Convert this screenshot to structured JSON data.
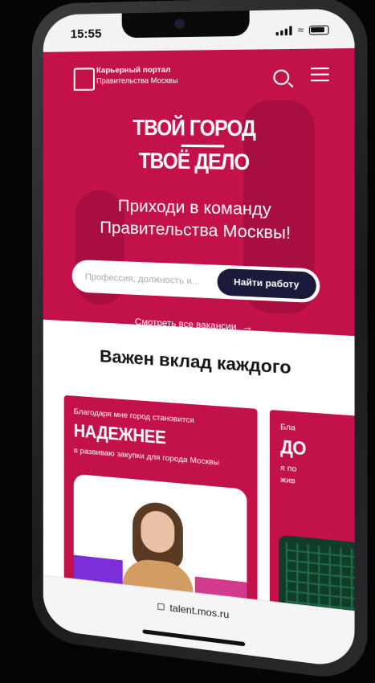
{
  "status": {
    "time": "15:55"
  },
  "header": {
    "portal_line1": "Карьерный портал",
    "portal_line2": "Правительства Москвы"
  },
  "hero": {
    "slogan_line1": "ТВОЙ ГОРОД",
    "slogan_line2": "ТВОЁ ДЕЛО",
    "invite_line1": "Приходи в команду",
    "invite_line2": "Правительства Москвы!",
    "search_placeholder": "Профессия, должность и...",
    "find_button": "Найти работу",
    "all_vacancies": "Смотреть все вакансии",
    "arrow": "→"
  },
  "section": {
    "title": "Важен вклад каждого"
  },
  "cards": [
    {
      "intro": "Благодаря мне город становится",
      "big": "НАДЕЖНЕЕ",
      "sub": "я развиваю закупки для города Москвы"
    },
    {
      "intro": "Бла",
      "big": "ДО",
      "sub": "я по",
      "sub2": "жив"
    }
  ],
  "browser": {
    "url": "talent.mos.ru"
  },
  "colors": {
    "brand": "#c3124a",
    "button": "#1c1a3a"
  }
}
